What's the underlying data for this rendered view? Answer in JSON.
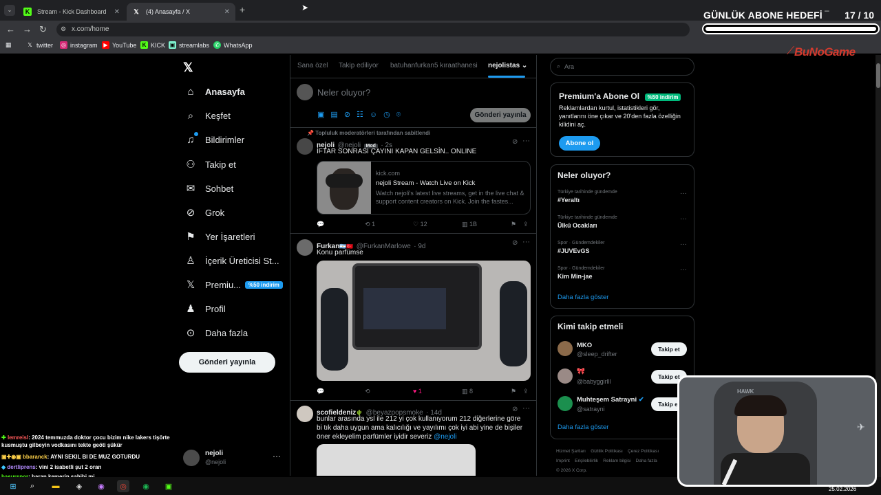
{
  "browser": {
    "tabs": [
      {
        "label": "Stream - Kick Dashboard",
        "active": false
      },
      {
        "label": "(4) Anasayfa / X",
        "active": true
      }
    ],
    "url": "x.com/home",
    "bookmarks": [
      "twitter",
      "instagram",
      "YouTube",
      "KICK",
      "streamlabs",
      "WhatsApp"
    ]
  },
  "overlay": {
    "goal_title": "GÜNLÜK ABONE HEDEFİ",
    "goal_current": "17",
    "goal_total": "/ 10",
    "goal_progress": 1.0,
    "brand_logo": "BuNoGame"
  },
  "sidebar": {
    "items": [
      {
        "label": "Anasayfa",
        "icon": "home-icon"
      },
      {
        "label": "Keşfet",
        "icon": "search-icon"
      },
      {
        "label": "Bildirimler",
        "icon": "bell-icon"
      },
      {
        "label": "Takip et",
        "icon": "add-user-icon"
      },
      {
        "label": "Sohbet",
        "icon": "mail-icon"
      },
      {
        "label": "Grok",
        "icon": "grok-icon"
      },
      {
        "label": "Yer İşaretleri",
        "icon": "bookmark-icon"
      },
      {
        "label": "İçerik Üreticisi St...",
        "icon": "creator-icon"
      },
      {
        "label": "Premiu...",
        "icon": "x-logo-icon",
        "badge": "%50 indirim"
      },
      {
        "label": "Profil",
        "icon": "person-icon"
      },
      {
        "label": "Daha fazla",
        "icon": "more-icon"
      }
    ],
    "post_button": "Gönderi yayınla",
    "account_name": "nejoli",
    "account_handle": "@nejoli"
  },
  "feed": {
    "tabs": [
      "Sana özel",
      "Takip ediliyor",
      "batuhanfurkan5 kıraathanesi",
      "nejolistas"
    ],
    "compose_placeholder": "Neler oluyor?",
    "compose_button": "Gönderi yayınla",
    "tweets": [
      {
        "pinned_note": "Topluluk moderatörleri tarafından sabitlendi",
        "name": "nejoli",
        "handle": "@nejoli",
        "badge": "Mod",
        "time": "· 2s",
        "text": "İFTAR SONRASI ÇAYINI KAPAN GELSİN.. ONLINE",
        "card": {
          "domain": "kick.com",
          "title": "nejoli Stream - Watch Live on Kick",
          "desc": "Watch nejoli's latest live streams, get in the live chat & support content creators on Kick. Join the fastes..."
        },
        "reposts": "1",
        "likes": "12",
        "views": "1B"
      },
      {
        "name": "Furkan",
        "handle": "@FurkanMarlowe",
        "time": "· 9d",
        "text": "Konu parfümse",
        "likes": "1",
        "views": "8"
      },
      {
        "name": "scofieldeniz",
        "handle": "@beyazpopsmoke",
        "time": "· 14d",
        "text": "bunlar arasında ysl ile 212 yi çok kullanıyorum 212 diğerlerine göre bi tık daha uygun ama kalıcılığı ve yayılımı çok iyi abi yine de bişiler öner ekleyelim parfümler iyidir severiz",
        "mention": "@nejoli"
      }
    ]
  },
  "right": {
    "search_placeholder": "Ara",
    "premium": {
      "title": "Premium'a Abone Ol",
      "badge": "%50 indirim",
      "text": "Reklamlardan kurtul, istatistikleri gör, yanıtlarını öne çıkar ve 20'den fazla özelliğin kilidini aç.",
      "button": "Abone ol"
    },
    "trends": {
      "title": "Neler oluyor?",
      "items": [
        {
          "context": "Türkiye tarihinde gündemde",
          "topic": "#Yeraltı"
        },
        {
          "context": "Türkiye tarihinde gündemde",
          "topic": "Ülkü Ocakları"
        },
        {
          "context": "Spor · Gündemdekiler",
          "topic": "#JUVEvGS"
        },
        {
          "context": "Spor · Gündemdekiler",
          "topic": "Kim Min-jae"
        }
      ],
      "more": "Daha fazla göster"
    },
    "who_to_follow": {
      "title": "Kimi takip etmeli",
      "users": [
        {
          "name": "MKO",
          "handle": "@sleep_drifter"
        },
        {
          "name": "🎀",
          "handle": "@babyggirlll"
        },
        {
          "name": "Muhteşem Satrayni",
          "handle": "@satrayni"
        }
      ],
      "follow_label": "Takip et",
      "more": "Daha fazla göster"
    },
    "footer": [
      "Hizmet Şartları",
      "Gizlilik Politikası",
      "Çerez Politikası",
      "Imprint",
      "Erişilebilirlik",
      "Reklam bilgisi",
      "Daha fazla",
      "© 2026 X Corp."
    ]
  },
  "chat": [
    {
      "user": "lemreisl",
      "text": ": 2024 temmuzda doktor çocu bizim nike lakers tişörte kusmuştu gilbeyin vodkasını tekte geöti şükür",
      "color": "#ff5a5a"
    },
    {
      "user": "bbaranck",
      "text": ": AYNI SEKIL BI DE MUZ GOTURDU",
      "color": "#ffd24a"
    },
    {
      "user": "dertliprens",
      "text": ": vini 2 isabetli şut 2 oran",
      "color": "#b48cff"
    },
    {
      "user": "basurspor",
      "text": ": baran kemerin sahibi mi",
      "color": "#53fc18"
    }
  ],
  "taskbar": {
    "date": "25.02.2026"
  },
  "webcam": {
    "chair_logo": "HAWK"
  }
}
